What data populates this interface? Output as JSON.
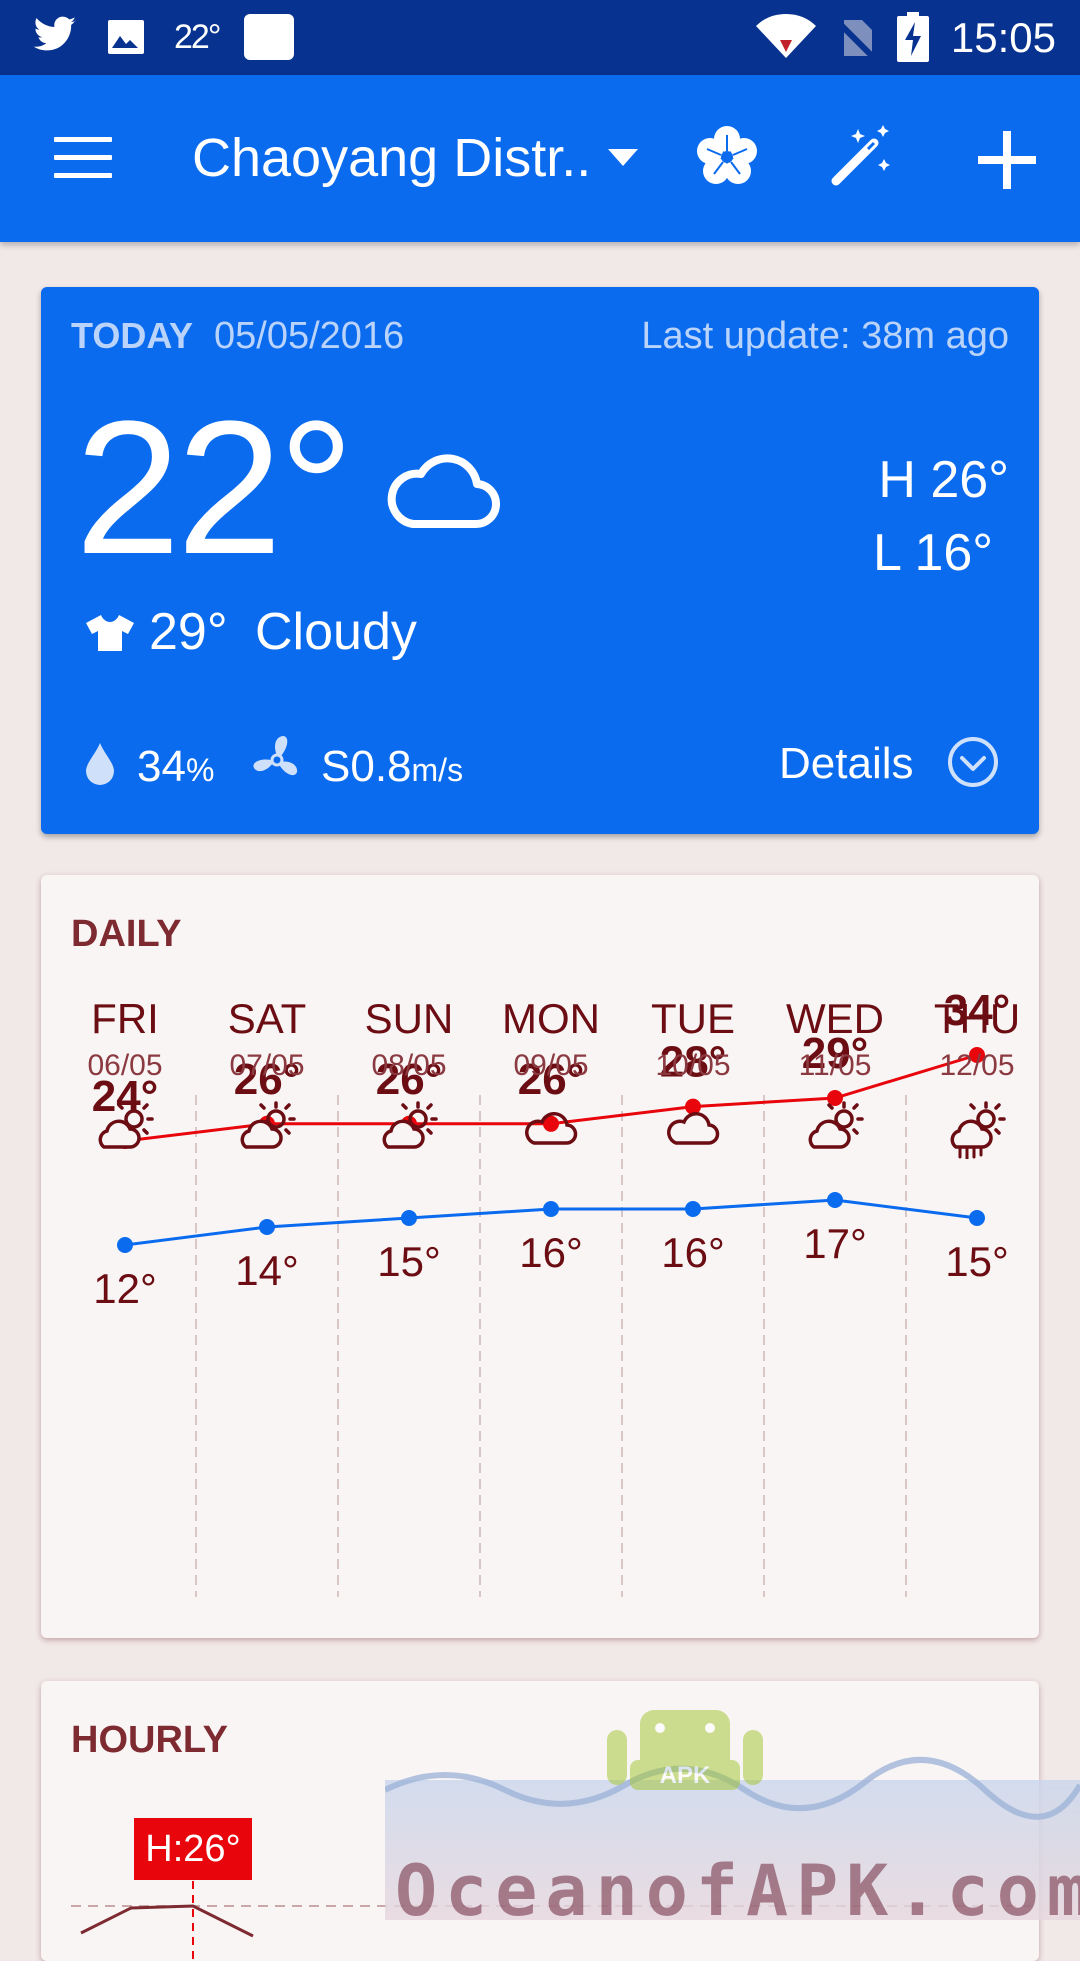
{
  "status_bar": {
    "temp": "22°",
    "time": "15:05"
  },
  "app_bar": {
    "city": "Chaoyang Distr..",
    "icons": [
      "menu-icon",
      "dropdown-caret-icon",
      "flower-theme-icon",
      "magic-wand-icon",
      "plus-icon"
    ]
  },
  "today": {
    "label": "TODAY",
    "date": "05/05/2016",
    "last_update": "Last update: 38m ago",
    "temp": "22°",
    "high": "H 26°",
    "low": "L 16°",
    "feels_like": "29°",
    "condition": "Cloudy",
    "humidity": "34",
    "humidity_unit": "%",
    "wind": "S0.8",
    "wind_unit": "m/s",
    "details": "Details"
  },
  "daily": {
    "title": "DAILY",
    "days": [
      {
        "name": "FRI",
        "date": "06/05",
        "icon": "partly-cloudy-icon",
        "high": "24°",
        "low": "12°"
      },
      {
        "name": "SAT",
        "date": "07/05",
        "icon": "partly-cloudy-icon",
        "high": "26°",
        "low": "14°"
      },
      {
        "name": "SUN",
        "date": "08/05",
        "icon": "partly-cloudy-icon",
        "high": "26°",
        "low": "15°"
      },
      {
        "name": "MON",
        "date": "09/05",
        "icon": "cloud-icon",
        "high": "26°",
        "low": "16°"
      },
      {
        "name": "TUE",
        "date": "10/05",
        "icon": "cloud-icon",
        "high": "28°",
        "low": "16°"
      },
      {
        "name": "WED",
        "date": "11/05",
        "icon": "partly-cloudy-icon",
        "high": "29°",
        "low": "17°"
      },
      {
        "name": "THU",
        "date": "12/05",
        "icon": "rain-sun-icon",
        "high": "34°",
        "low": "15°"
      }
    ],
    "high_values": [
      24,
      26,
      26,
      26,
      28,
      29,
      34
    ],
    "low_values": [
      12,
      14,
      15,
      16,
      16,
      17,
      15
    ],
    "high_color": "#e8050b",
    "low_color": "#0a6bef"
  },
  "hourly": {
    "title": "HOURLY",
    "high_badge": "H:26°"
  },
  "watermark": {
    "text": "OceanofAPK.com",
    "logo_text": "APK"
  },
  "colors": {
    "primary": "#0a6bef",
    "status_bar": "#07328f",
    "text_dark_red": "#6b0d12"
  }
}
